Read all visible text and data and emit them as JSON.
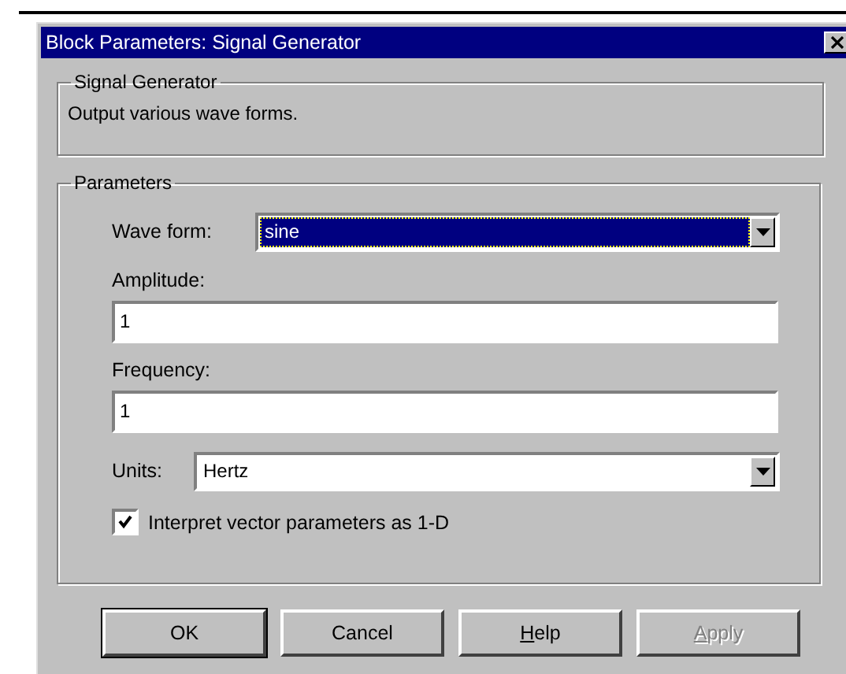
{
  "window": {
    "title": "Block Parameters: Signal Generator"
  },
  "description_group": {
    "title": "Signal Generator",
    "text": "Output various wave forms."
  },
  "parameters_group": {
    "title": "Parameters",
    "fields": [
      {
        "kind": "dropdown",
        "label": "Wave form:",
        "value": "sine",
        "focused": true
      },
      {
        "kind": "text",
        "label": "Amplitude:",
        "value": "1"
      },
      {
        "kind": "text",
        "label": "Frequency:",
        "value": "1"
      },
      {
        "kind": "dropdown",
        "label": "Units:",
        "value": "Hertz",
        "focused": false
      },
      {
        "kind": "checkbox",
        "label": "Interpret vector parameters as 1-D",
        "checked": true
      }
    ]
  },
  "buttons": [
    {
      "label": "OK",
      "default": true,
      "disabled": false,
      "mnemonic_underlined": false
    },
    {
      "label": "Cancel",
      "default": false,
      "disabled": false,
      "mnemonic_underlined": false
    },
    {
      "label": "Help",
      "default": false,
      "disabled": false,
      "mnemonic_underlined": true
    },
    {
      "label": "Apply",
      "default": false,
      "disabled": true,
      "mnemonic_underlined": true
    }
  ]
}
